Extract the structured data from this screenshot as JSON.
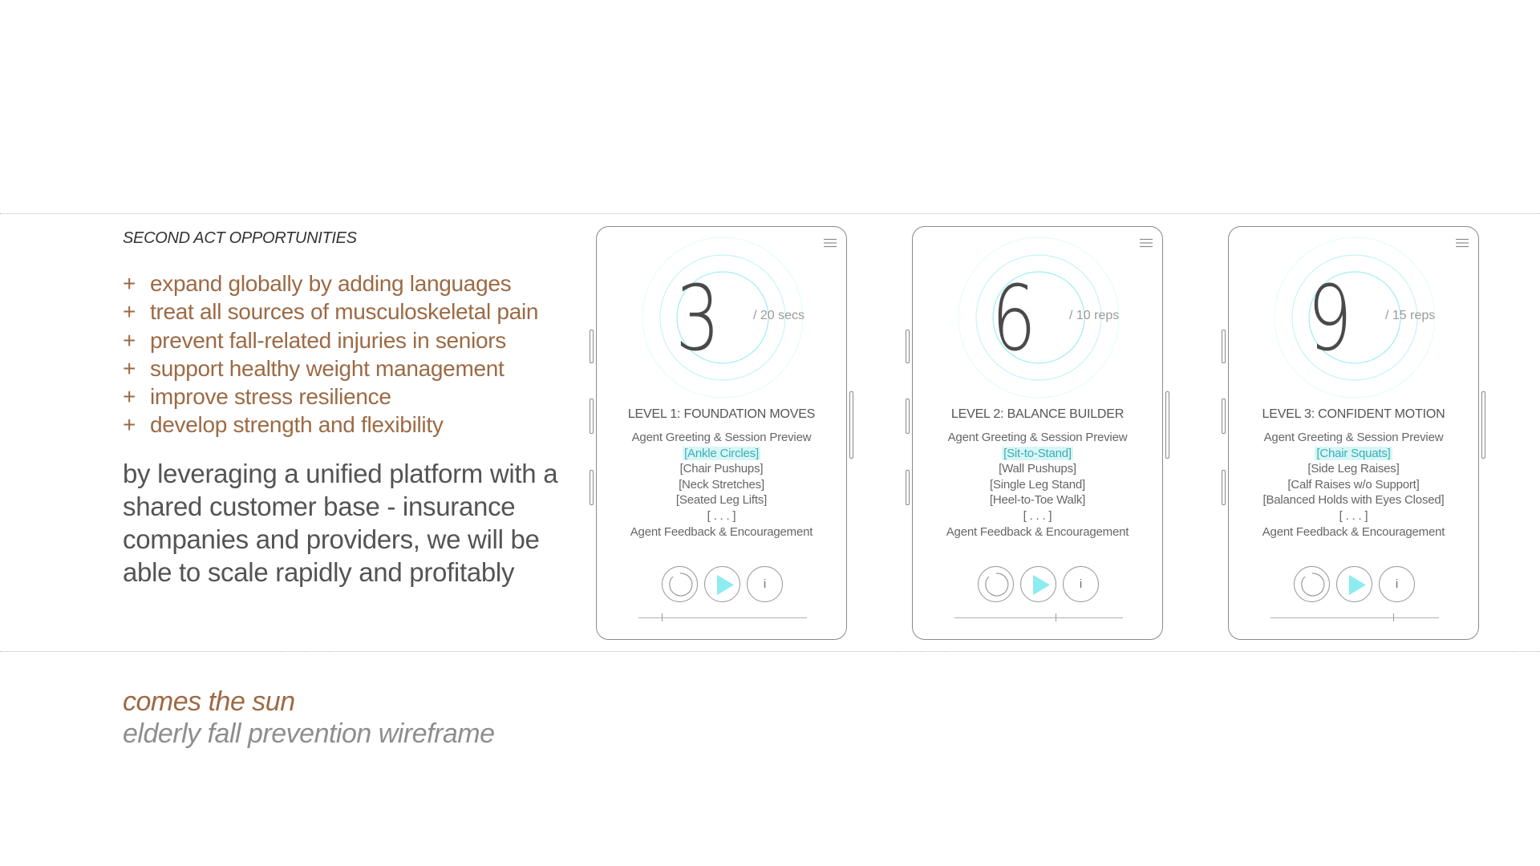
{
  "colors": {
    "brand": "#9c6a44",
    "accent": "#8cecef",
    "highlight_bg": "#d9f6f7",
    "frame": "#8a8a8a"
  },
  "left": {
    "section_heading": "SECOND ACT OPPORTUNITIES",
    "bullet_marker": "+",
    "opportunities": [
      "expand globally by adding languages",
      "treat all sources of musculoskeletal pain",
      "prevent fall-related injuries in seniors",
      "support healthy weight management",
      "improve stress resilience",
      "develop strength and flexibility"
    ],
    "leverage_text": "by leveraging a unified platform with a shared customer base - insurance companies and providers, we will be able to scale rapidly and profitably"
  },
  "footer": {
    "title": "comes the sun",
    "subtitle": "elderly fall prevention wireframe"
  },
  "phones": [
    {
      "count": "3",
      "unit": "/ 20 secs",
      "level_title": "LEVEL 1: FOUNDATION MOVES",
      "lines": [
        "Agent Greeting & Session Preview",
        "[Ankle Circles]",
        "[Chair Pushups]",
        "[Neck Stretches]",
        "[Seated Leg Lifts]",
        "[ . . . ]",
        "Agent Feedback & Encouragement"
      ],
      "highlight_index": 1,
      "info_glyph": "i",
      "progress": 0.14,
      "icons": [
        "menu-icon",
        "replay-icon",
        "play-icon",
        "info-icon"
      ]
    },
    {
      "count": "6",
      "unit": "/ 10 reps",
      "level_title": "LEVEL 2: BALANCE BUILDER",
      "lines": [
        "Agent Greeting & Session Preview",
        "[Sit-to-Stand]",
        "[Wall Pushups]",
        "[Single Leg Stand]",
        "[Heel-to-Toe Walk]",
        "[ . . . ]",
        "Agent Feedback & Encouragement"
      ],
      "highlight_index": 1,
      "info_glyph": "i",
      "progress": 0.6,
      "icons": [
        "menu-icon",
        "replay-icon",
        "play-icon",
        "info-icon"
      ]
    },
    {
      "count": "9",
      "unit": "/ 15 reps",
      "level_title": "LEVEL 3: CONFIDENT MOTION",
      "lines": [
        "Agent Greeting & Session Preview",
        "[Chair Squats]",
        "[Side Leg Raises]",
        "[Calf Raises w/o Support]",
        "[Balanced Holds with Eyes Closed]",
        "[ . . . ]",
        "Agent Feedback & Encouragement"
      ],
      "highlight_index": 1,
      "info_glyph": "i",
      "progress": 0.73,
      "icons": [
        "menu-icon",
        "replay-icon",
        "play-icon",
        "info-icon"
      ]
    }
  ]
}
